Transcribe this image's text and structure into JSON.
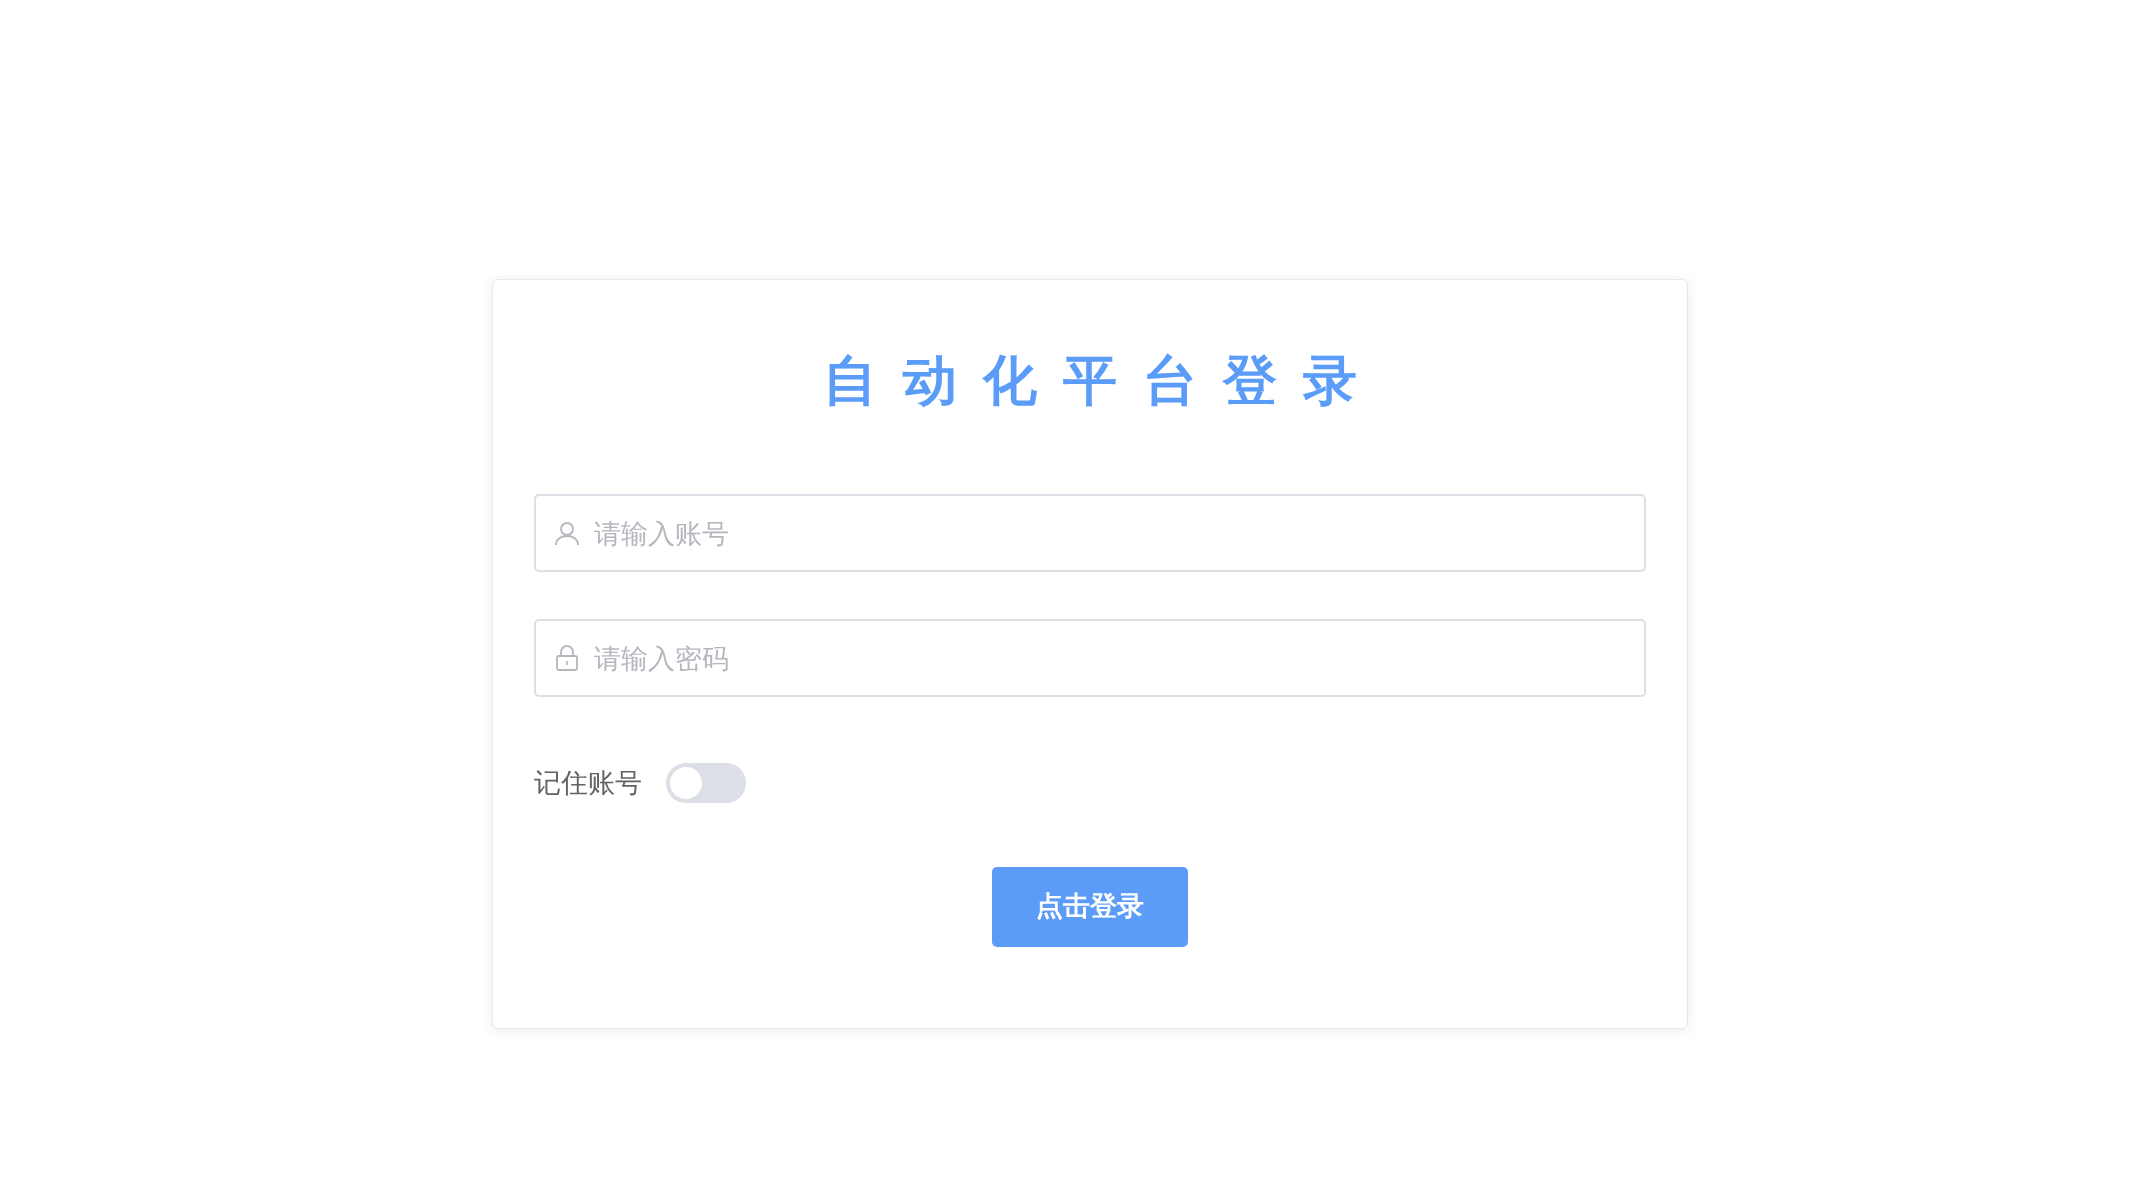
{
  "title": "自动化平台登录",
  "fields": [
    {
      "kind": "user",
      "placeholder": "请输入账号"
    },
    {
      "kind": "password",
      "placeholder": "请输入密码"
    }
  ],
  "remember": {
    "label": "记住账号",
    "on": false
  },
  "login_button": "点击登录"
}
